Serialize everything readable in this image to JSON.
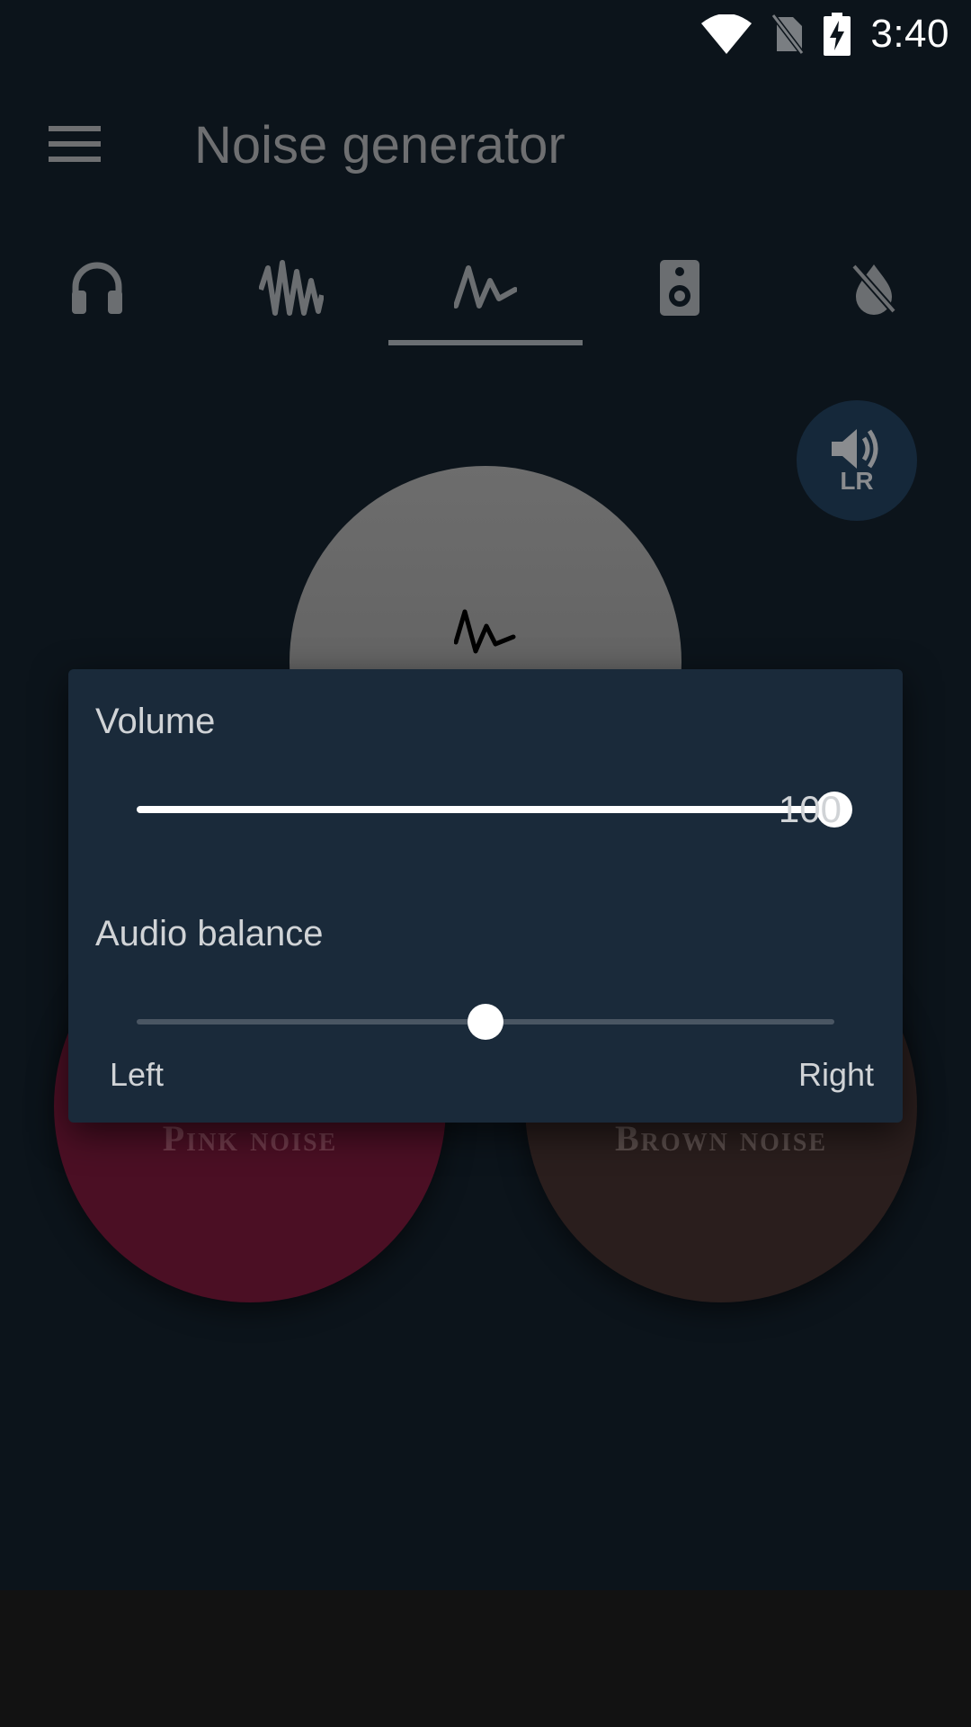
{
  "status_bar": {
    "time": "3:40",
    "icons": [
      "wifi-icon",
      "no-sim-icon",
      "battery-charging-icon"
    ]
  },
  "app_bar": {
    "title": "Noise generator",
    "menu_icon": "menu-icon"
  },
  "tabs": [
    {
      "icon": "headphones-icon",
      "selected": false
    },
    {
      "icon": "waveform-icon",
      "selected": false
    },
    {
      "icon": "pulse-wave-icon",
      "selected": true
    },
    {
      "icon": "speaker-icon",
      "selected": false
    },
    {
      "icon": "no-drop-icon",
      "selected": false
    }
  ],
  "balance_fab": {
    "icon": "volume-icon",
    "label": "LR"
  },
  "noise_circles": {
    "top_icon": "pulse-wave-icon",
    "pink_label": "Pink noise",
    "brown_label": "Brown noise"
  },
  "dialog": {
    "volume_label": "Volume",
    "volume_value": "100",
    "volume_fraction": 1.0,
    "balance_label": "Audio balance",
    "balance_fraction": 0.5,
    "balance_left": "Left",
    "balance_right": "Right"
  },
  "colors": {
    "background": "#0c141b",
    "dialog": "#1a2a3a",
    "pink_circle": "#4b0f24",
    "brown_circle": "#2a1e1d",
    "top_circle": "#666666"
  }
}
